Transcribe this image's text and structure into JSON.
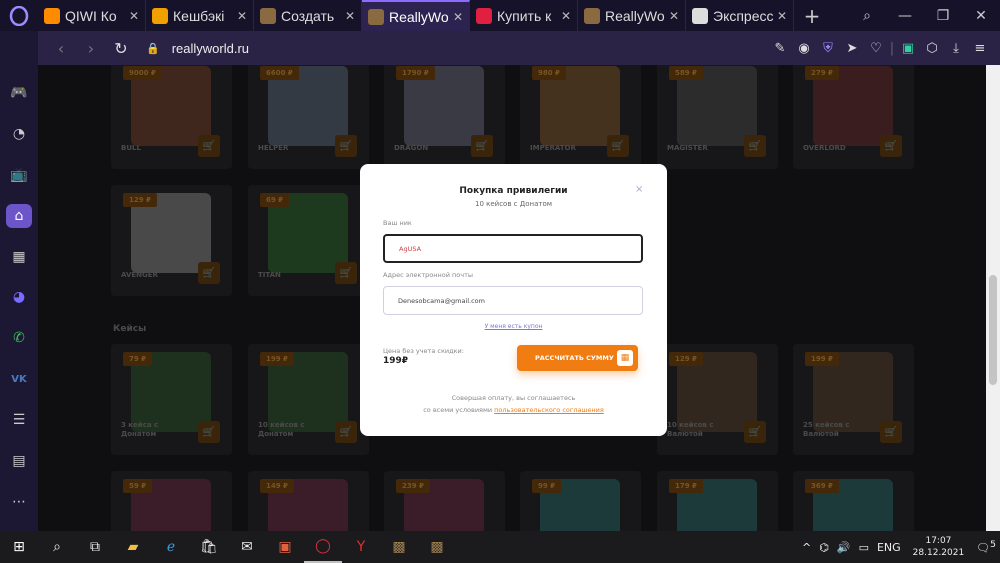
{
  "browser": {
    "tabs": [
      {
        "title": "QIWI Ко",
        "icon_color": "#ff8c00"
      },
      {
        "title": "Кешбэкі",
        "icon_color": "#f0a000"
      },
      {
        "title": "Создать",
        "icon_color": "#8a6a40"
      },
      {
        "title": "ReallyWo",
        "icon_color": "#8a6a40",
        "active": true
      },
      {
        "title": "Купить к",
        "icon_color": "#e02040"
      },
      {
        "title": "ReallyWo",
        "icon_color": "#8a6a40"
      },
      {
        "title": "Экспресс",
        "icon_color": "#dddddd"
      }
    ],
    "new_tab": "+",
    "url": "reallyworld.ru"
  },
  "products_row1": [
    {
      "price": "9000 ₽",
      "name": "BULL",
      "color": "#b06040"
    },
    {
      "price": "6600 ₽",
      "name": "HELPER",
      "color": "#8aa0c0"
    },
    {
      "price": "1790 ₽",
      "name": "DRAGON",
      "color": "#a0a0c0"
    },
    {
      "price": "980 ₽",
      "name": "IMPERATOR",
      "color": "#c08040"
    },
    {
      "price": "589 ₽",
      "name": "MAGISTER",
      "color": "#707070"
    },
    {
      "price": "279 ₽",
      "name": "OVERLORD",
      "color": "#a04040"
    }
  ],
  "products_row2": [
    {
      "price": "129 ₽",
      "name": "AVENGER",
      "color": "#d0d0d0"
    },
    {
      "price": "69 ₽",
      "name": "TITAN",
      "color": "#40a040"
    }
  ],
  "section_cases": "Кейсы",
  "cases_row": [
    {
      "price": "79 ₽",
      "name": "3 кейса с Донатом",
      "color": "#408040"
    },
    {
      "price": "199 ₽",
      "name": "10 кейсов с Донатом",
      "color": "#408040"
    },
    {
      "price": "129 ₽",
      "name": "10 кейсов с Валютой",
      "color": "#806040"
    },
    {
      "price": "199 ₽",
      "name": "25 кейсов с Валютой",
      "color": "#806040"
    }
  ],
  "cases_row2": [
    {
      "price": "59 ₽",
      "color": "#a04060"
    },
    {
      "price": "149 ₽",
      "color": "#a04060"
    },
    {
      "price": "239 ₽",
      "color": "#a04060"
    },
    {
      "price": "99 ₽",
      "color": "#40a0a0"
    },
    {
      "price": "179 ₽",
      "color": "#40a0a0"
    },
    {
      "price": "369 ₽",
      "color": "#40a0a0"
    }
  ],
  "modal": {
    "title": "Покупка привилегии",
    "subtitle": "10 кейсов с Донатом",
    "nick_label": "Ваш ник",
    "nick_value": "AgUSA",
    "email_label": "Адрес электронной почты",
    "email_value": "Denesobcama@gmail.com",
    "coupon_link": "У меня есть купон",
    "price_label": "Цена без учета скидки:",
    "price_value": "199₽",
    "calc_button": "РАССЧИТАТЬ СУММУ",
    "terms_line1": "Совершая оплату, вы соглашаетесь",
    "terms_line2": "со всеми условиями",
    "terms_link": "пользовательского соглашения",
    "close": "×"
  },
  "taskbar": {
    "lang": "ENG",
    "time": "17:07",
    "date": "28.12.2021",
    "notif": "5"
  }
}
